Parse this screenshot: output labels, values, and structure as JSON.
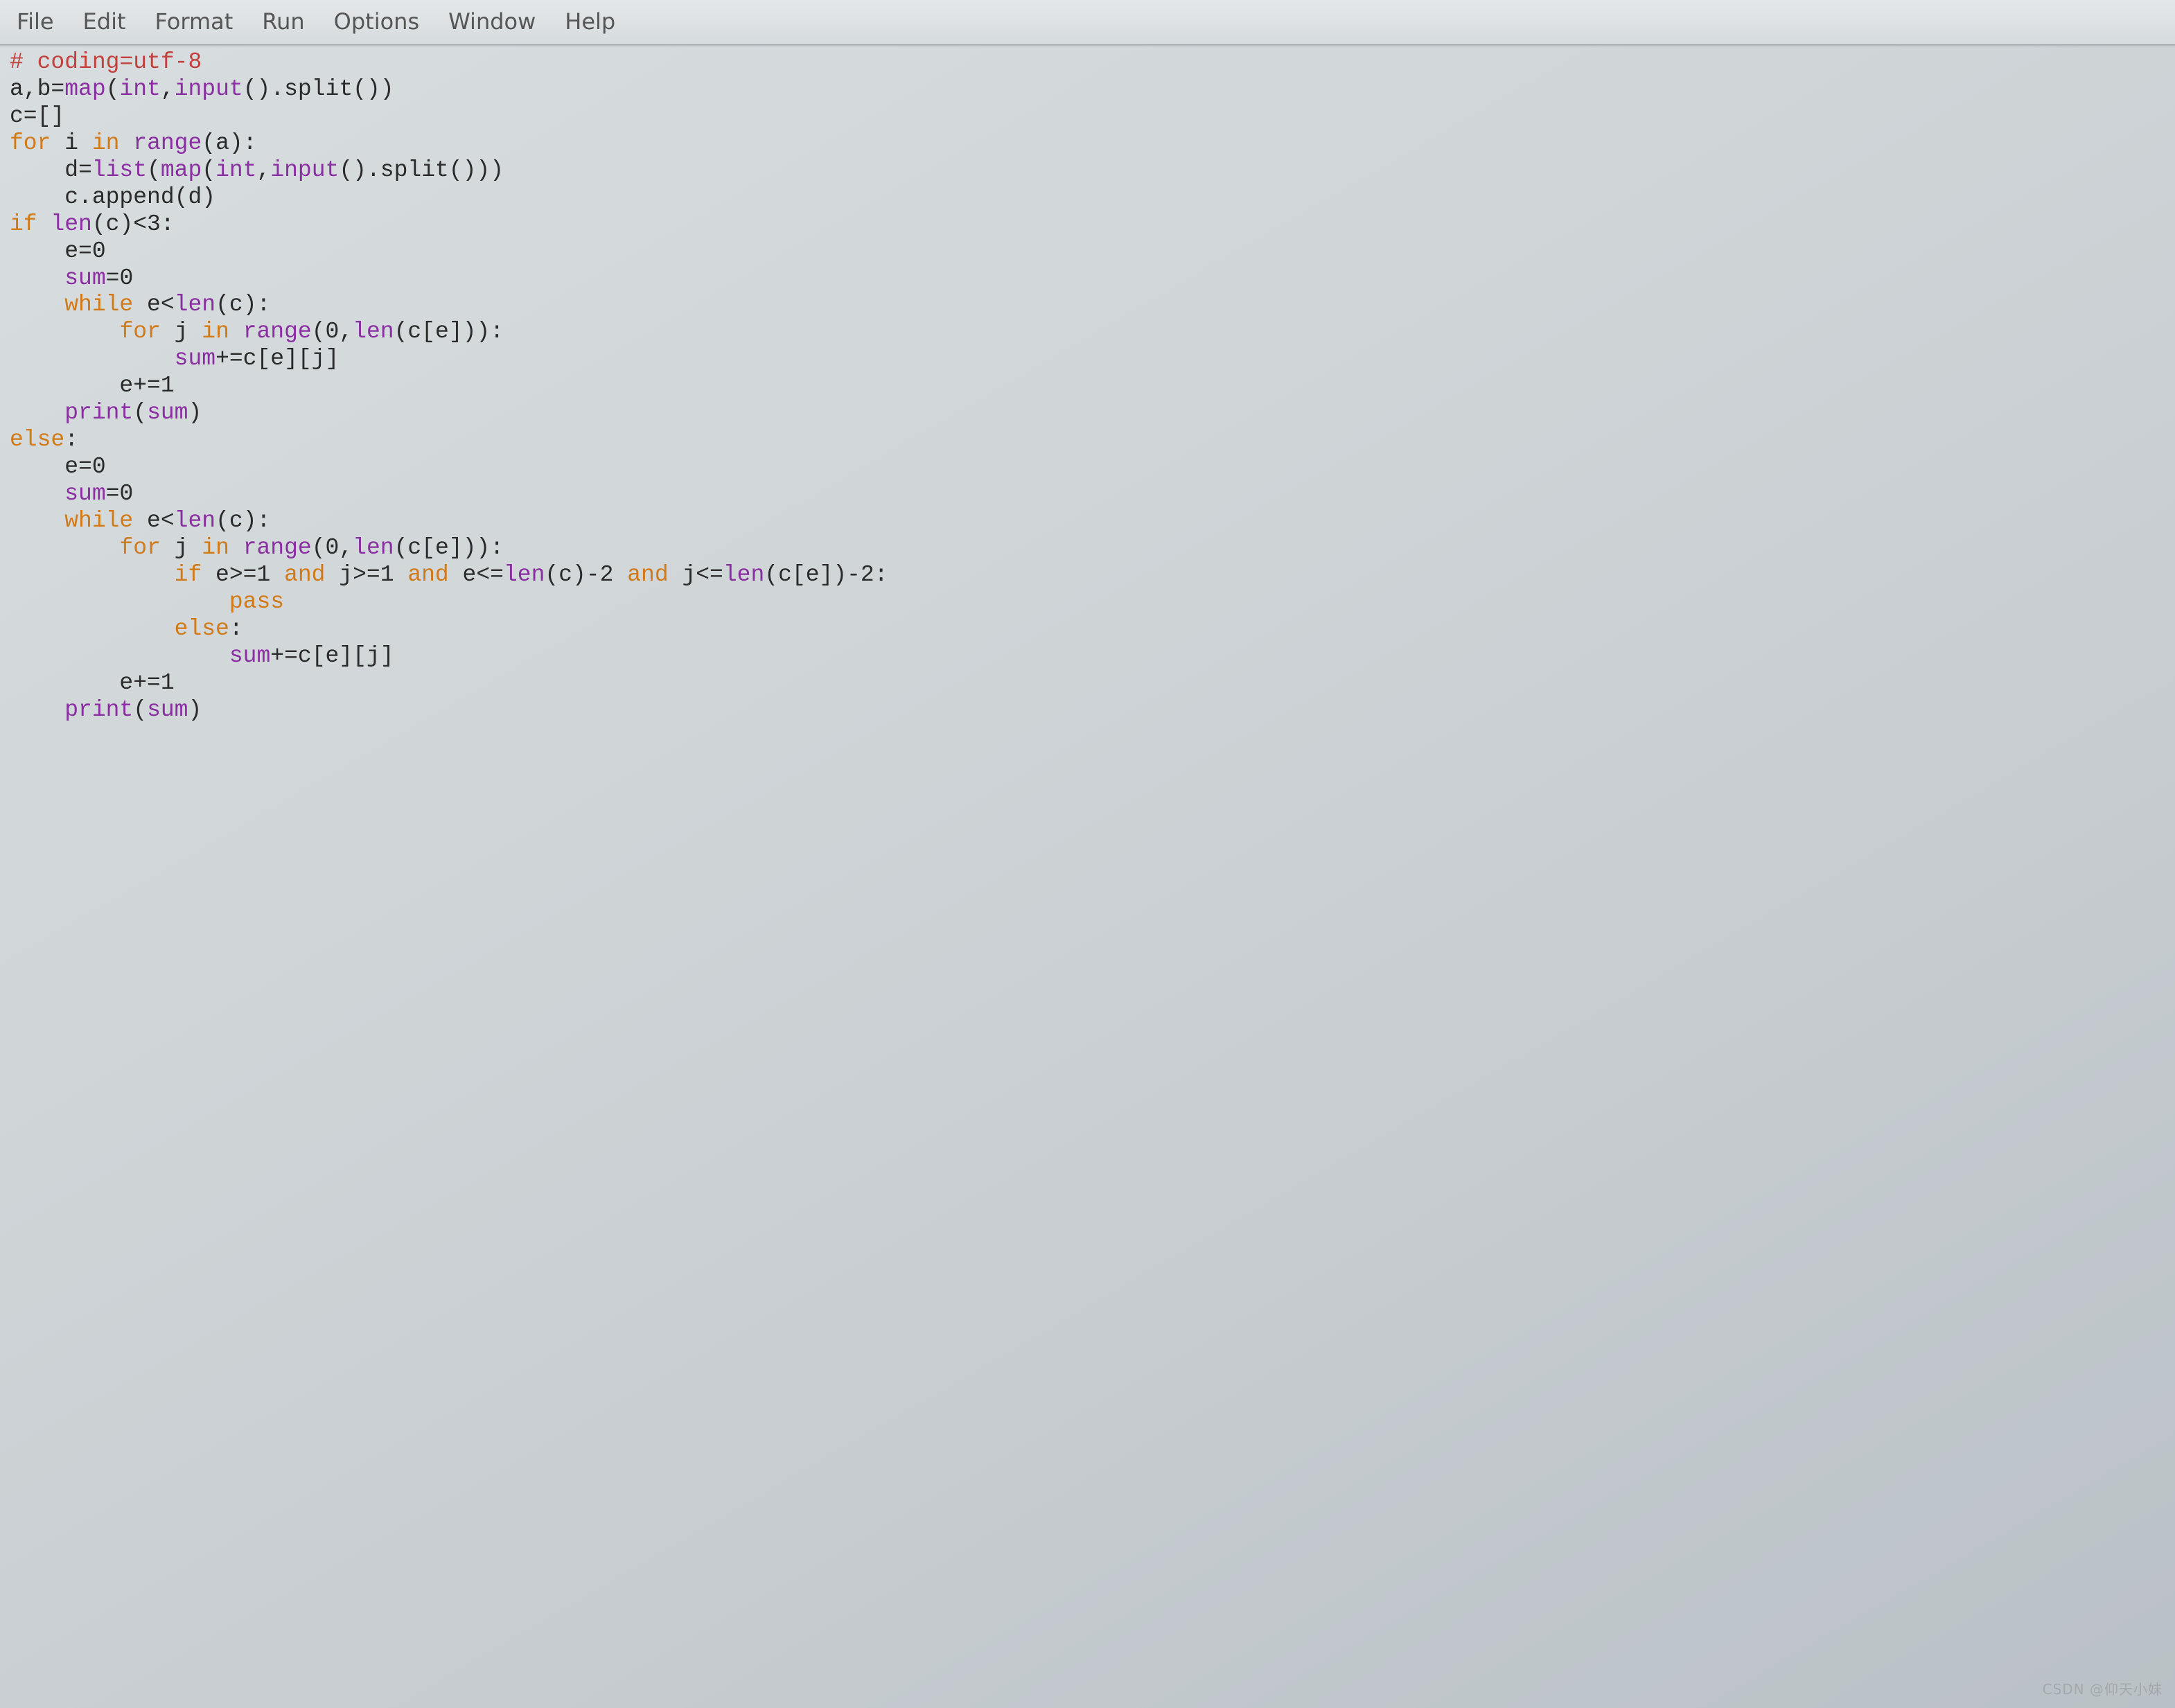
{
  "menu": {
    "file": "File",
    "edit": "Edit",
    "format": "Format",
    "run": "Run",
    "options": "Options",
    "window": "Window",
    "help": "Help"
  },
  "code": {
    "l01_comment": "# coding=utf-8",
    "l02_a": "a,b=",
    "l02_b": "map",
    "l02_c": "(",
    "l02_d": "int",
    "l02_e": ",",
    "l02_f": "input",
    "l02_g": "().split())",
    "l03": "c=[]",
    "l04_a": "for",
    "l04_b": " i ",
    "l04_c": "in",
    "l04_d": " ",
    "l04_e": "range",
    "l04_f": "(a):",
    "l05_a": "    d=",
    "l05_b": "list",
    "l05_c": "(",
    "l05_d": "map",
    "l05_e": "(",
    "l05_f": "int",
    "l05_g": ",",
    "l05_h": "input",
    "l05_i": "().split()))",
    "l06": "    c.append(d)",
    "l07_a": "if",
    "l07_b": " ",
    "l07_c": "len",
    "l07_d": "(c)<3:",
    "l08": "    e=0",
    "l09_a": "    ",
    "l09_b": "sum",
    "l09_c": "=0",
    "l10_a": "    ",
    "l10_b": "while",
    "l10_c": " e<",
    "l10_d": "len",
    "l10_e": "(c):",
    "l11_a": "        ",
    "l11_b": "for",
    "l11_c": " j ",
    "l11_d": "in",
    "l11_e": " ",
    "l11_f": "range",
    "l11_g": "(0,",
    "l11_h": "len",
    "l11_i": "(c[e])):",
    "l12_a": "            ",
    "l12_b": "sum",
    "l12_c": "+=c[e][j]",
    "l13": "        e+=1",
    "l14_a": "    ",
    "l14_b": "print",
    "l14_c": "(",
    "l14_d": "sum",
    "l14_e": ")",
    "l15_a": "else",
    "l15_b": ":",
    "l16": "    e=0",
    "l17_a": "    ",
    "l17_b": "sum",
    "l17_c": "=0",
    "l18_a": "    ",
    "l18_b": "while",
    "l18_c": " e<",
    "l18_d": "len",
    "l18_e": "(c):",
    "l19_a": "        ",
    "l19_b": "for",
    "l19_c": " j ",
    "l19_d": "in",
    "l19_e": " ",
    "l19_f": "range",
    "l19_g": "(0,",
    "l19_h": "len",
    "l19_i": "(c[e])):",
    "l20_a": "            ",
    "l20_b": "if",
    "l20_c": " e>=1 ",
    "l20_d": "and",
    "l20_e": " j>=1 ",
    "l20_f": "and",
    "l20_g": " e<=",
    "l20_h": "len",
    "l20_i": "(c)-2 ",
    "l20_j": "and",
    "l20_k": " j<=",
    "l20_l": "len",
    "l20_m": "(c[e])-2:",
    "l21_a": "                ",
    "l21_b": "pass",
    "l22_a": "            ",
    "l22_b": "else",
    "l22_c": ":",
    "l23_a": "                ",
    "l23_b": "sum",
    "l23_c": "+=c[e][j]",
    "l24": "        e+=1",
    "l25_a": "    ",
    "l25_b": "print",
    "l25_c": "(",
    "l25_d": "sum",
    "l25_e": ")"
  },
  "watermark": "CSDN @仰天小妹"
}
